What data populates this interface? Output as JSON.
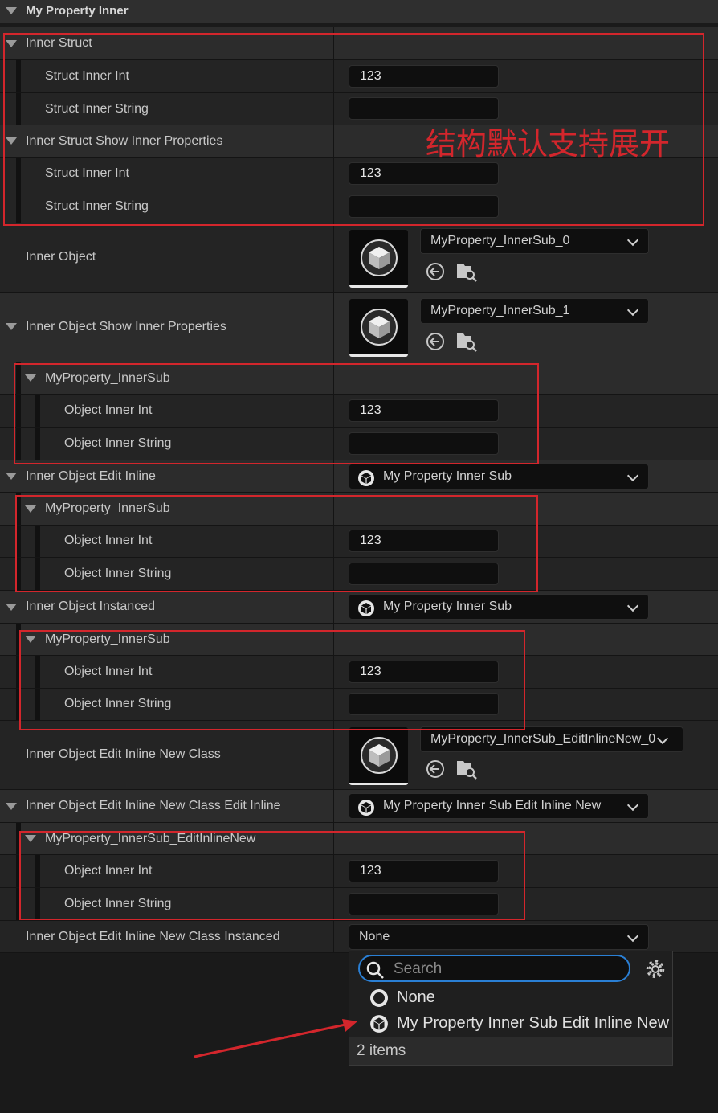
{
  "category": {
    "title": "My Property Inner"
  },
  "rows": {
    "inner_struct": "Inner Struct",
    "s1_int_label": "Struct Inner Int",
    "s1_int_value": "123",
    "s1_str_label": "Struct Inner String",
    "s1_str_value": "",
    "inner_struct_show": "Inner Struct Show Inner Properties",
    "s2_int_label": "Struct Inner Int",
    "s2_int_value": "123",
    "s2_str_label": "Struct Inner String",
    "s2_str_value": "",
    "inner_object": "Inner Object",
    "inner_object_value": "MyProperty_InnerSub_0",
    "inner_object_show": "Inner Object Show Inner Properties",
    "inner_object_show_value": "MyProperty_InnerSub_1",
    "sub1_header": "MyProperty_InnerSub",
    "sub1_int_label": "Object Inner Int",
    "sub1_int_value": "123",
    "sub1_str_label": "Object Inner String",
    "sub1_str_value": "",
    "edit_inline": "Inner Object Edit Inline",
    "edit_inline_value": "My Property Inner Sub",
    "sub2_header": "MyProperty_InnerSub",
    "sub2_int_label": "Object Inner Int",
    "sub2_int_value": "123",
    "sub2_str_label": "Object Inner String",
    "sub2_str_value": "",
    "instanced": "Inner Object Instanced",
    "instanced_value": "My Property Inner Sub",
    "sub3_header": "MyProperty_InnerSub",
    "sub3_int_label": "Object Inner Int",
    "sub3_int_value": "123",
    "sub3_str_label": "Object Inner String",
    "sub3_str_value": "",
    "ein_class": "Inner Object Edit Inline New Class",
    "ein_class_value": "MyProperty_InnerSub_EditInlineNew_0",
    "ein_class_edit_inline": "Inner Object Edit Inline New Class Edit Inline",
    "ein_class_edit_inline_value": "My Property Inner Sub Edit Inline New",
    "sub4_header": "MyProperty_InnerSub_EditInlineNew",
    "sub4_int_label": "Object Inner Int",
    "sub4_int_value": "123",
    "sub4_str_label": "Object Inner String",
    "sub4_str_value": "",
    "ein_class_instanced": "Inner Object Edit Inline New Class Instanced",
    "ein_class_instanced_value": "None"
  },
  "annotation": {
    "text": "结构默认支持展开",
    "color": "#d3262c"
  },
  "dropdown": {
    "search_placeholder": "Search",
    "options": [
      "None",
      "My Property Inner Sub Edit Inline New"
    ],
    "count": "2 items"
  },
  "colors": {
    "accent": "#2a7fd4",
    "highlight": "#d3262c"
  }
}
